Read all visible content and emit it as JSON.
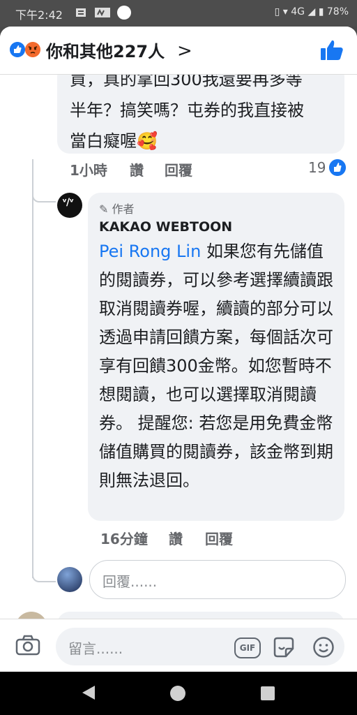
{
  "status_bar": {
    "time": "下午2:42",
    "network": "4G",
    "battery": "78%"
  },
  "header": {
    "reactions_text": "你和其他227人",
    "chevron": ">"
  },
  "comment": {
    "text_lines": [
      "買，真的拿回300我還要再多等",
      "半年？搞笑嗎？屯券的我直接被",
      "當白癡喔🥰"
    ],
    "time": "1小時",
    "like_label": "讚",
    "reply_label": "回覆",
    "like_count": "19"
  },
  "reply": {
    "badge": "作者",
    "author": "KAKAO WEBTOON",
    "mention": "Pei Rong Lin",
    "body": "如果您有先儲值的閱讀券，可以參考選擇續讀跟取消閱讀券喔，續讀的部分可以透過申請回饋方案，每個話次可享有回饋300金幣。如您暫時不想閱讀，也可以選擇取消閱讀券。 提醒您: 若您是用免費金幣儲值購買的閱讀券，該金幣到期則無法退回。",
    "time": "16分鐘",
    "like_label": "讚",
    "reply_label": "回覆"
  },
  "reply_input": {
    "placeholder": "回覆......"
  },
  "composer": {
    "placeholder": "留言......",
    "gif_label": "GIF"
  },
  "colors": {
    "facebook_blue": "#1877f2",
    "bubble_gray": "#f0f2f5",
    "angry_orange": "#f36b2e"
  }
}
